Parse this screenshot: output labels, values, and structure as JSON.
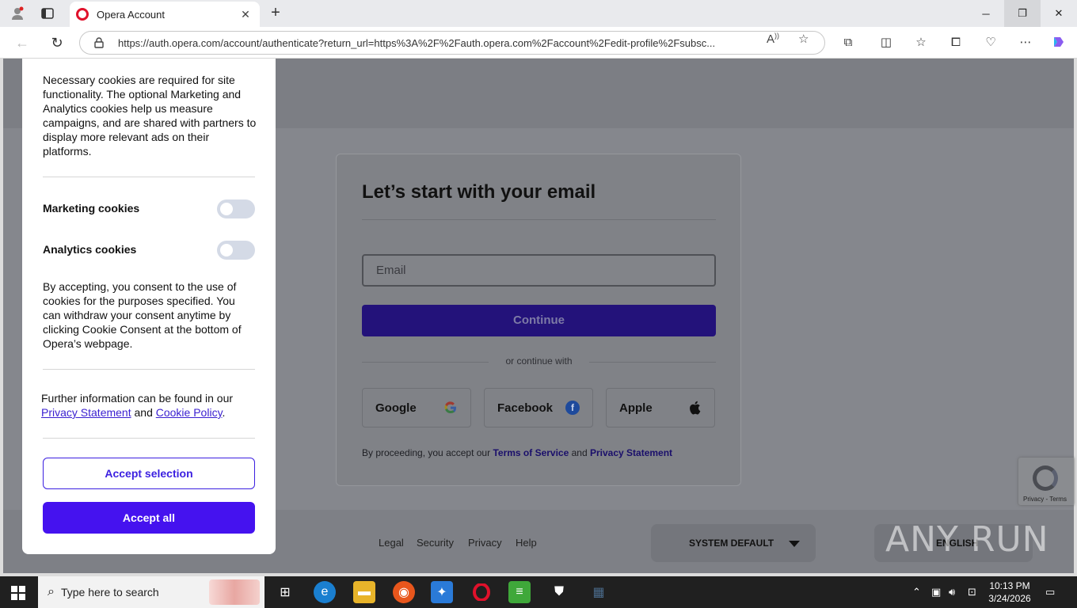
{
  "browser": {
    "tab_title": "Opera Account",
    "url": "https://auth.opera.com/account/authenticate?return_url=https%3A%2F%2Fauth.opera.com%2Faccount%2Fedit-profile%2Fsubsc...",
    "colors": {
      "tab_favicon": "#e0112b"
    }
  },
  "cookie_panel": {
    "intro": "Necessary cookies are required for site functionality. The optional Marketing and Analytics cookies help us measure campaigns, and are shared with partners to display more relevant ads on their platforms.",
    "toggles": [
      {
        "label": "Marketing cookies",
        "on": false
      },
      {
        "label": "Analytics cookies",
        "on": false
      }
    ],
    "consent_text": "By accepting, you consent to the use of cookies for the purposes specified. You can withdraw your consent anytime by clicking Cookie Consent at the bottom of Opera’s webpage.",
    "further_info_prefix": "Further information can be found in our",
    "privacy_link": "Privacy Statement",
    "and": "and",
    "cookie_link": "Cookie Policy",
    "period": ".",
    "accept_selection": "Accept selection",
    "accept_all": "Accept all",
    "colors": {
      "accent": "#4512ef"
    }
  },
  "signin": {
    "heading": "Let’s start with your email",
    "email_placeholder": "Email",
    "continue": "Continue",
    "or_continue_with": "or continue with",
    "social": [
      "Google",
      "Facebook",
      "Apple"
    ],
    "terms_prefix": "By proceeding, you accept our",
    "terms_link": "Terms of Service",
    "terms_and": "and",
    "privacy_link": "Privacy Statement"
  },
  "recaptcha": {
    "text": "Privacy - Terms"
  },
  "footer": {
    "links": [
      "Legal",
      "Security",
      "Privacy",
      "Help"
    ],
    "theme_select": "SYSTEM DEFAULT",
    "language_select": "ENGLISH"
  },
  "watermark": "ANY RUN",
  "taskbar": {
    "search_placeholder": "Type here to search",
    "time": "10:13 PM",
    "date": "3/24/2026"
  }
}
